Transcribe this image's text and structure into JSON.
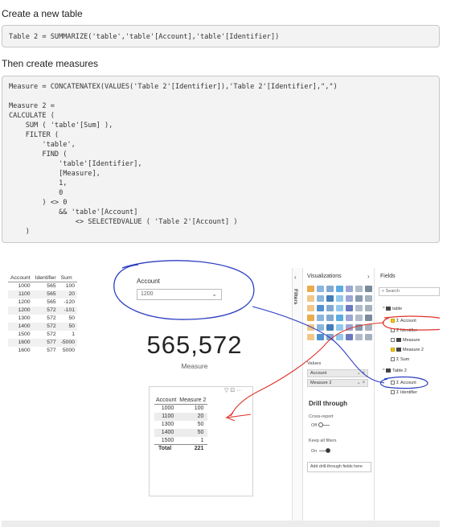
{
  "headings": {
    "create_table": "Create a new table",
    "create_measures": "Then create measures"
  },
  "code1": "Table 2 = SUMMARIZE('table','table'[Account],'table'[Identifier])",
  "code2": "Measure = CONCATENATEX(VALUES('Table 2'[Identifier]),'Table 2'[Identifier],\",\")\n\nMeasure 2 =\nCALCULATE (\n    SUM ( 'table'[Sum] ),\n    FILTER (\n        'table',\n        FIND (\n            'table'[Identifier],\n            [Measure],\n            1,\n            0\n        ) <> 0\n            && 'table'[Account]\n                <> SELECTEDVALUE ( 'Table 2'[Account] )\n    )",
  "source_table": {
    "headers": [
      "Account",
      "Identifier",
      "Sum"
    ],
    "rows": [
      [
        "1000",
        "565",
        "100"
      ],
      [
        "1100",
        "565",
        "20"
      ],
      [
        "1200",
        "565",
        "-120"
      ],
      [
        "1200",
        "572",
        "-101"
      ],
      [
        "1300",
        "572",
        "50"
      ],
      [
        "1400",
        "572",
        "50"
      ],
      [
        "1500",
        "572",
        "1"
      ],
      [
        "1600",
        "577",
        "-5000"
      ],
      [
        "1600",
        "577",
        "5000"
      ]
    ]
  },
  "slicer": {
    "title": "Account",
    "value": "1200"
  },
  "card": {
    "value": "565,572",
    "label": "Measure"
  },
  "matrix": {
    "headers": [
      "Account",
      "Measure 2"
    ],
    "rows": [
      [
        "1000",
        "100"
      ],
      [
        "1100",
        "20"
      ],
      [
        "1300",
        "50"
      ],
      [
        "1400",
        "50"
      ],
      [
        "1500",
        "1"
      ]
    ],
    "total_label": "Total",
    "total_value": "221",
    "icons": "▽ ⊡ ···"
  },
  "panes": {
    "filters": "Filters",
    "visualizations": "Visualizations",
    "fields": "Fields",
    "search_placeholder": "Search",
    "values_label": "Values",
    "wells": [
      "Account",
      "Measure 2"
    ],
    "drillthrough": "Drill through",
    "cross_report": "Cross-report",
    "off": "Off",
    "keep_all_filters": "Keep all filters",
    "on": "On",
    "add_drill": "Add drill-through fields here",
    "table1": "table",
    "table1_fields": [
      "Account",
      "Identifier",
      "Measure",
      "Measure 2",
      "Sum"
    ],
    "table2": "Table 2",
    "table2_fields": [
      "Account",
      "Identifier"
    ]
  },
  "viz_icon_colors": [
    "#e8a33b",
    "#3c86c8",
    "#2f6fb3",
    "#4aa3df",
    "#5b6ab8",
    "#7b8fa6",
    "#6a7d92"
  ],
  "annotation_colors": {
    "blue": "#2b3fc2",
    "red": "#e0332a"
  }
}
